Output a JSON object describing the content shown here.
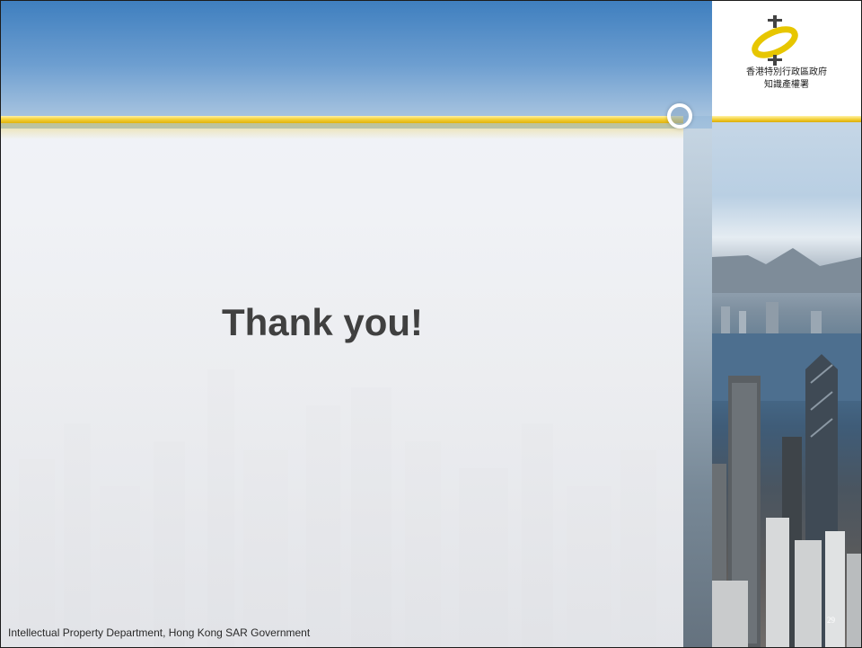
{
  "slide": {
    "title": "Thank you!",
    "footer": "Intellectual Property Department, Hong Kong SAR Government",
    "page_number": "29"
  },
  "logo": {
    "line1": "香港特別行政區政府",
    "line2": "知識產權署"
  },
  "colors": {
    "gold": "#f6d23a",
    "top_band": "#4f8ac4",
    "title_text": "#404040"
  }
}
